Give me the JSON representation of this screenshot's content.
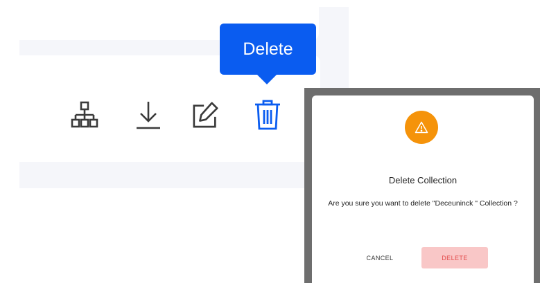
{
  "toolbar": {
    "tooltip_label": "Delete",
    "icons": [
      "hierarchy-icon",
      "download-icon",
      "edit-icon",
      "trash-icon"
    ]
  },
  "dialog": {
    "title": "Delete Collection",
    "message": "Are you sure you want to delete \"Deceuninck \" Collection ?",
    "cancel_label": "CANCEL",
    "delete_label": "DELETE",
    "warning_icon": "warning-icon"
  },
  "colors": {
    "accent": "#0a5cf0",
    "warning": "#f5930a",
    "danger_text": "#e34b4b",
    "danger_bg": "#f9c7c7"
  }
}
